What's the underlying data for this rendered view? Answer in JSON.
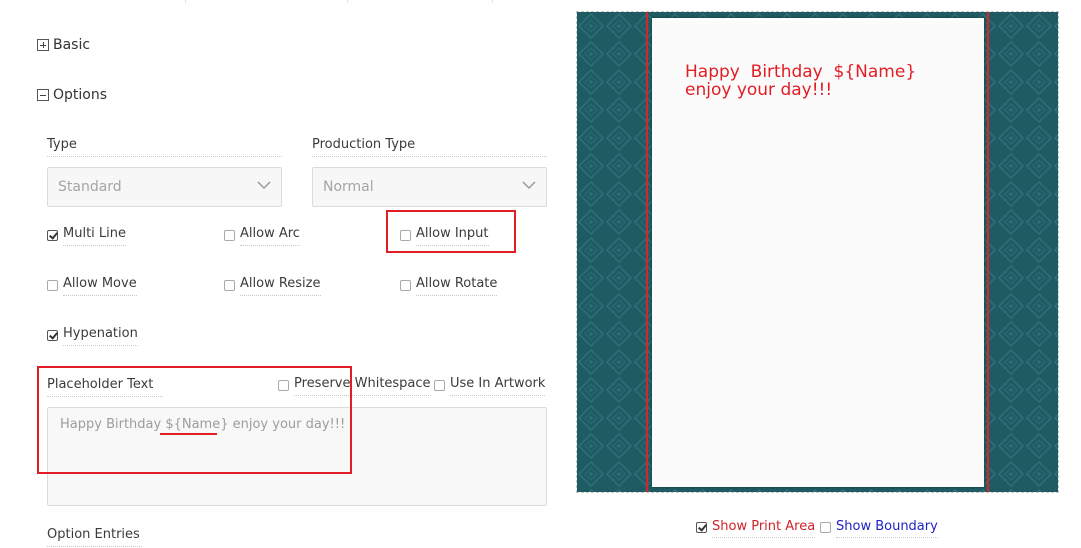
{
  "sections": {
    "basic": {
      "label": "Basic",
      "icon": "plus-square-icon"
    },
    "options": {
      "label": "Options",
      "icon": "minus-square-icon"
    }
  },
  "fields": {
    "type": {
      "label": "Type",
      "value": "Standard"
    },
    "production_type": {
      "label": "Production Type",
      "value": "Normal"
    }
  },
  "checkboxes": {
    "multi_line": {
      "label": "Multi Line",
      "checked": true
    },
    "allow_arc": {
      "label": "Allow Arc",
      "checked": false
    },
    "allow_input": {
      "label": "Allow Input",
      "checked": false
    },
    "allow_move": {
      "label": "Allow Move",
      "checked": false
    },
    "allow_resize": {
      "label": "Allow Resize",
      "checked": false
    },
    "allow_rotate": {
      "label": "Allow Rotate",
      "checked": false
    },
    "hypenation": {
      "label": "Hypenation",
      "checked": true
    },
    "preserve_whitespace": {
      "label": "Preserve Whitespace",
      "checked": false
    },
    "use_in_artwork": {
      "label": "Use In Artwork",
      "checked": false
    }
  },
  "placeholder": {
    "label": "Placeholder Text",
    "before": "Happy Birthday ",
    "token": "${Name}",
    "after": " enjoy your day!!!"
  },
  "option_entries": {
    "label": "Option Entries"
  },
  "preview": {
    "line1": "Happy  Birthday  ${Name}",
    "line2": "enjoy your day!!!",
    "text_color": "#e21d24",
    "background_color": "#1f5b63"
  },
  "footer": {
    "show_print_area": {
      "label": "Show Print Area",
      "checked": true,
      "color": "#d12229"
    },
    "show_boundary": {
      "label": "Show Boundary",
      "checked": false,
      "color": "#1f23c2"
    }
  },
  "colors": {
    "highlight": "#e21d24"
  }
}
